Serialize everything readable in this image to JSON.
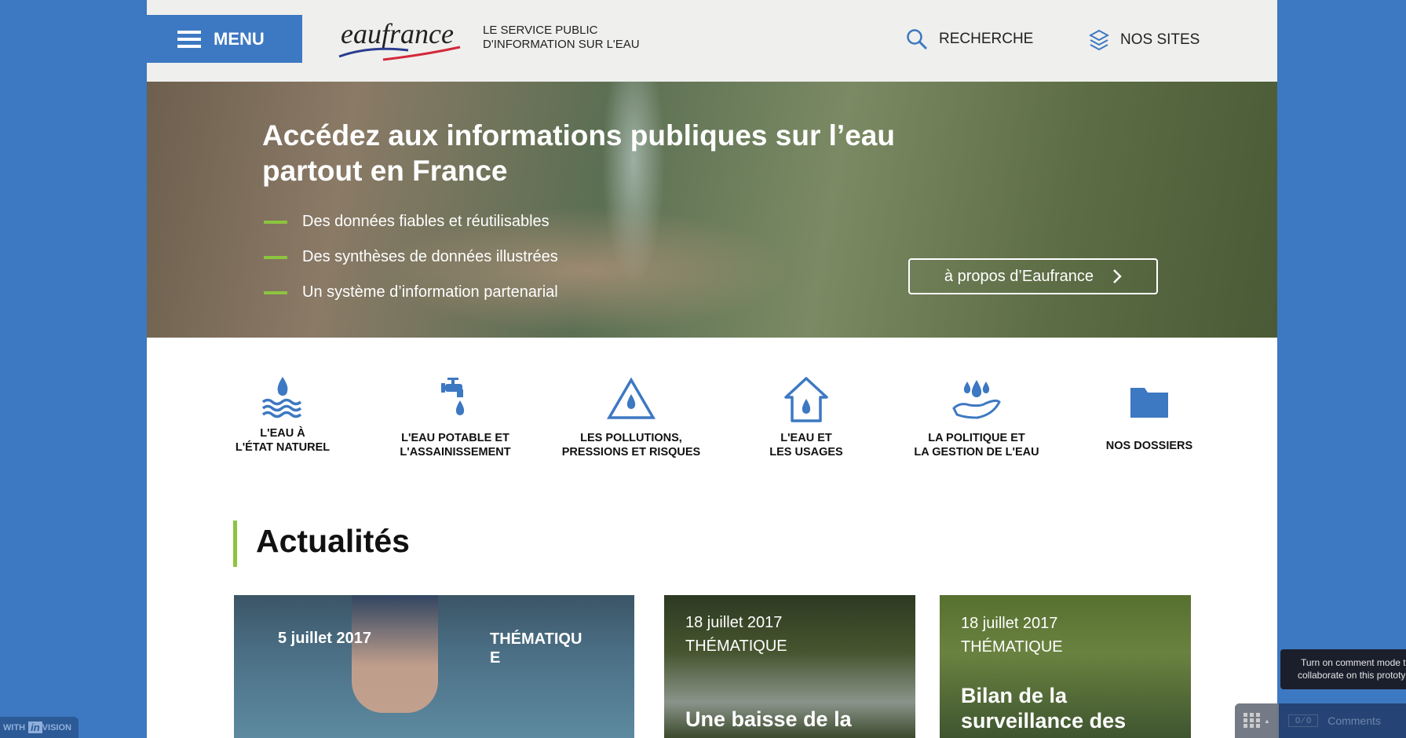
{
  "header": {
    "menu_label": "MENU",
    "logo_text": "eaufrance",
    "tagline_line1": "LE SERVICE PUBLIC",
    "tagline_line2": "D'INFORMATION SUR L'EAU",
    "search_label": "RECHERCHE",
    "sites_label": "NOS SITES"
  },
  "hero": {
    "title": "Accédez aux informations publiques sur l’eau partout en France",
    "bullets": [
      "Des données fiables et réutilisables",
      "Des synthèses de données illustrées",
      "Un système d’information partenarial"
    ],
    "about_label": "à propos d’Eaufrance"
  },
  "categories": [
    {
      "line1": "L'EAU À",
      "line2": "L'ÉTAT NATUREL"
    },
    {
      "line1": "L'EAU POTABLE ET",
      "line2": "L'ASSAINISSEMENT"
    },
    {
      "line1": "LES POLLUTIONS,",
      "line2": "PRESSIONS ET RISQUES"
    },
    {
      "line1": "L'EAU ET",
      "line2": "LES USAGES"
    },
    {
      "line1": "LA POLITIQUE ET",
      "line2": "LA GESTION DE L'EAU"
    },
    {
      "line1": "NOS DOSSIERS",
      "line2": ""
    }
  ],
  "news": {
    "title": "Actualités",
    "cards": [
      {
        "date": "5 juillet 2017",
        "theme": "THÉMATIQU E",
        "headline": ""
      },
      {
        "date": "18 juillet 2017",
        "theme": "THÉMATIQUE",
        "headline": "Une baisse de la"
      },
      {
        "date": "18 juillet 2017",
        "theme": "THÉMATIQUE",
        "headline": "Bilan de la surveillance des"
      }
    ]
  },
  "overlay": {
    "with": "WITH",
    "brand_in": "in",
    "brand_rest": "VISION",
    "tooltip_line1": "Turn on comment mode t",
    "tooltip_line2": "collaborate on this prototy",
    "count_a": "0",
    "count_b": "0",
    "comments_label": "Comments"
  },
  "colors": {
    "brand_blue": "#3d78c2",
    "accent_green": "#8cc43f"
  }
}
